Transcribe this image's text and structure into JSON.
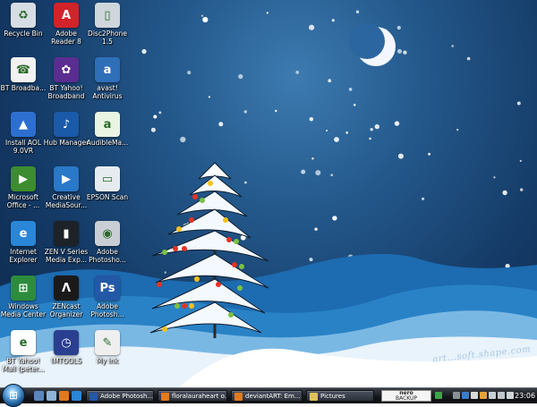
{
  "desktop": {
    "icons": [
      {
        "label": "Recycle Bin",
        "icon": "recycle-bin-icon",
        "color": "#d7dde4"
      },
      {
        "label": "Adobe Reader 8",
        "icon": "adobe-reader-icon",
        "color": "#d2232a"
      },
      {
        "label": "Disc2Phone 1.5",
        "icon": "phone-icon",
        "color": "#cfd6dc"
      },
      {
        "label": "BT Broadba...",
        "icon": "bt-phone-icon",
        "color": "#f2f2f2"
      },
      {
        "label": "BT Yahoo! Broadband",
        "icon": "yahoo-butterfly-icon",
        "color": "#5a2d91"
      },
      {
        "label": "avast! Antivirus",
        "icon": "avast-icon",
        "color": "#2f6fb8"
      },
      {
        "label": "Install AOL 9.0VR",
        "icon": "aol-icon",
        "color": "#2d6fd0"
      },
      {
        "label": "Hub Manager",
        "icon": "hub-manager-icon",
        "color": "#1a5aa8"
      },
      {
        "label": "AudibleMa...",
        "icon": "audible-icon",
        "color": "#e9f4e2"
      },
      {
        "label": "Microsoft Office - ...",
        "icon": "office-icon",
        "color": "#3d8c2f"
      },
      {
        "label": "Creative MediaSour...",
        "icon": "media-player-icon",
        "color": "#2a78c8"
      },
      {
        "label": "EPSON Scan",
        "icon": "scanner-icon",
        "color": "#e6ebf0"
      },
      {
        "label": "Internet Explorer",
        "icon": "internet-explorer-icon",
        "color": "#2a86d6"
      },
      {
        "label": "ZEN V Series Media Exp...",
        "icon": "zen-player-icon",
        "color": "#1c2228"
      },
      {
        "label": "Adobe Photosho...",
        "icon": "camera-icon",
        "color": "#c9ced4"
      },
      {
        "label": "Windows Media Center",
        "icon": "windows-media-center-icon",
        "color": "#2d8c3c"
      },
      {
        "label": "ZENcast Organizer",
        "icon": "zencast-icon",
        "color": "#1a1a1a"
      },
      {
        "label": "Adobe Photosh...",
        "icon": "photoshop-icon",
        "color": "#2358a6"
      },
      {
        "label": "BT Yahoo! Mail (peter...",
        "icon": "mail-icon",
        "color": "#ffffff"
      },
      {
        "label": "IMTOOLS",
        "icon": "imtools-icon",
        "color": "#2a3f8f"
      },
      {
        "label": "My ink",
        "icon": "ink-icon",
        "color": "#efefef"
      }
    ],
    "watermark": "art...soft.shape.com"
  },
  "taskbar": {
    "start_glyph": "⊞",
    "tasks": [
      {
        "label": "Adobe Photosh...",
        "icon": "photoshop-task-icon",
        "color": "#2358a6"
      },
      {
        "label": "floralauraheart o...",
        "icon": "firefox-task-icon",
        "color": "#e07a1f"
      },
      {
        "label": "deviantART: Em...",
        "icon": "firefox-task-icon",
        "color": "#e07a1f"
      },
      {
        "label": "Pictures",
        "icon": "folder-task-icon",
        "color": "#e0c060"
      }
    ],
    "tray_box": {
      "line1": "nero",
      "line2": "BACKUP"
    },
    "clock": "23:06"
  }
}
